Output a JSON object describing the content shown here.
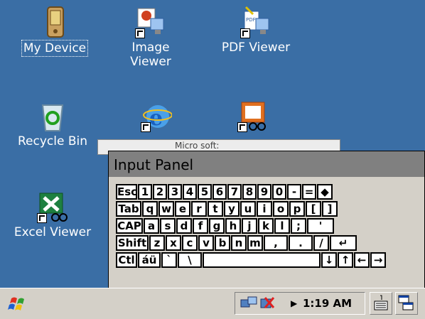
{
  "desktop": {
    "icons": [
      {
        "label": "My Device"
      },
      {
        "label": "Image\nViewer"
      },
      {
        "label": "PDF Viewer"
      },
      {
        "label": "Recycle Bin"
      },
      {
        "label": ""
      },
      {
        "label": ""
      },
      {
        "label": "Excel Viewer"
      }
    ],
    "behind_window_text": "Micro soft:"
  },
  "input_panel": {
    "title": "Input Panel",
    "rows": [
      [
        "Esc",
        "1",
        "2",
        "3",
        "4",
        "5",
        "6",
        "7",
        "8",
        "9",
        "0",
        "-",
        "=",
        "◆"
      ],
      [
        "Tab",
        "q",
        "w",
        "e",
        "r",
        "t",
        "y",
        "u",
        "i",
        "o",
        "p",
        "[",
        "]"
      ],
      [
        "CAP",
        "a",
        "s",
        "d",
        "f",
        "g",
        "h",
        "j",
        "k",
        "l",
        ";",
        "'"
      ],
      [
        "Shift",
        "z",
        "x",
        "c",
        "v",
        "b",
        "n",
        "m",
        ",",
        ".",
        "/",
        "↵"
      ],
      [
        "Ctl",
        "áü",
        "`",
        "\\",
        " ",
        "↓",
        "↑",
        "←",
        "→"
      ]
    ]
  },
  "taskbar": {
    "clock": "1:19 AM"
  },
  "colors": {
    "desktop": "#3a6ea5",
    "taskbar": "#d4d0c8"
  }
}
